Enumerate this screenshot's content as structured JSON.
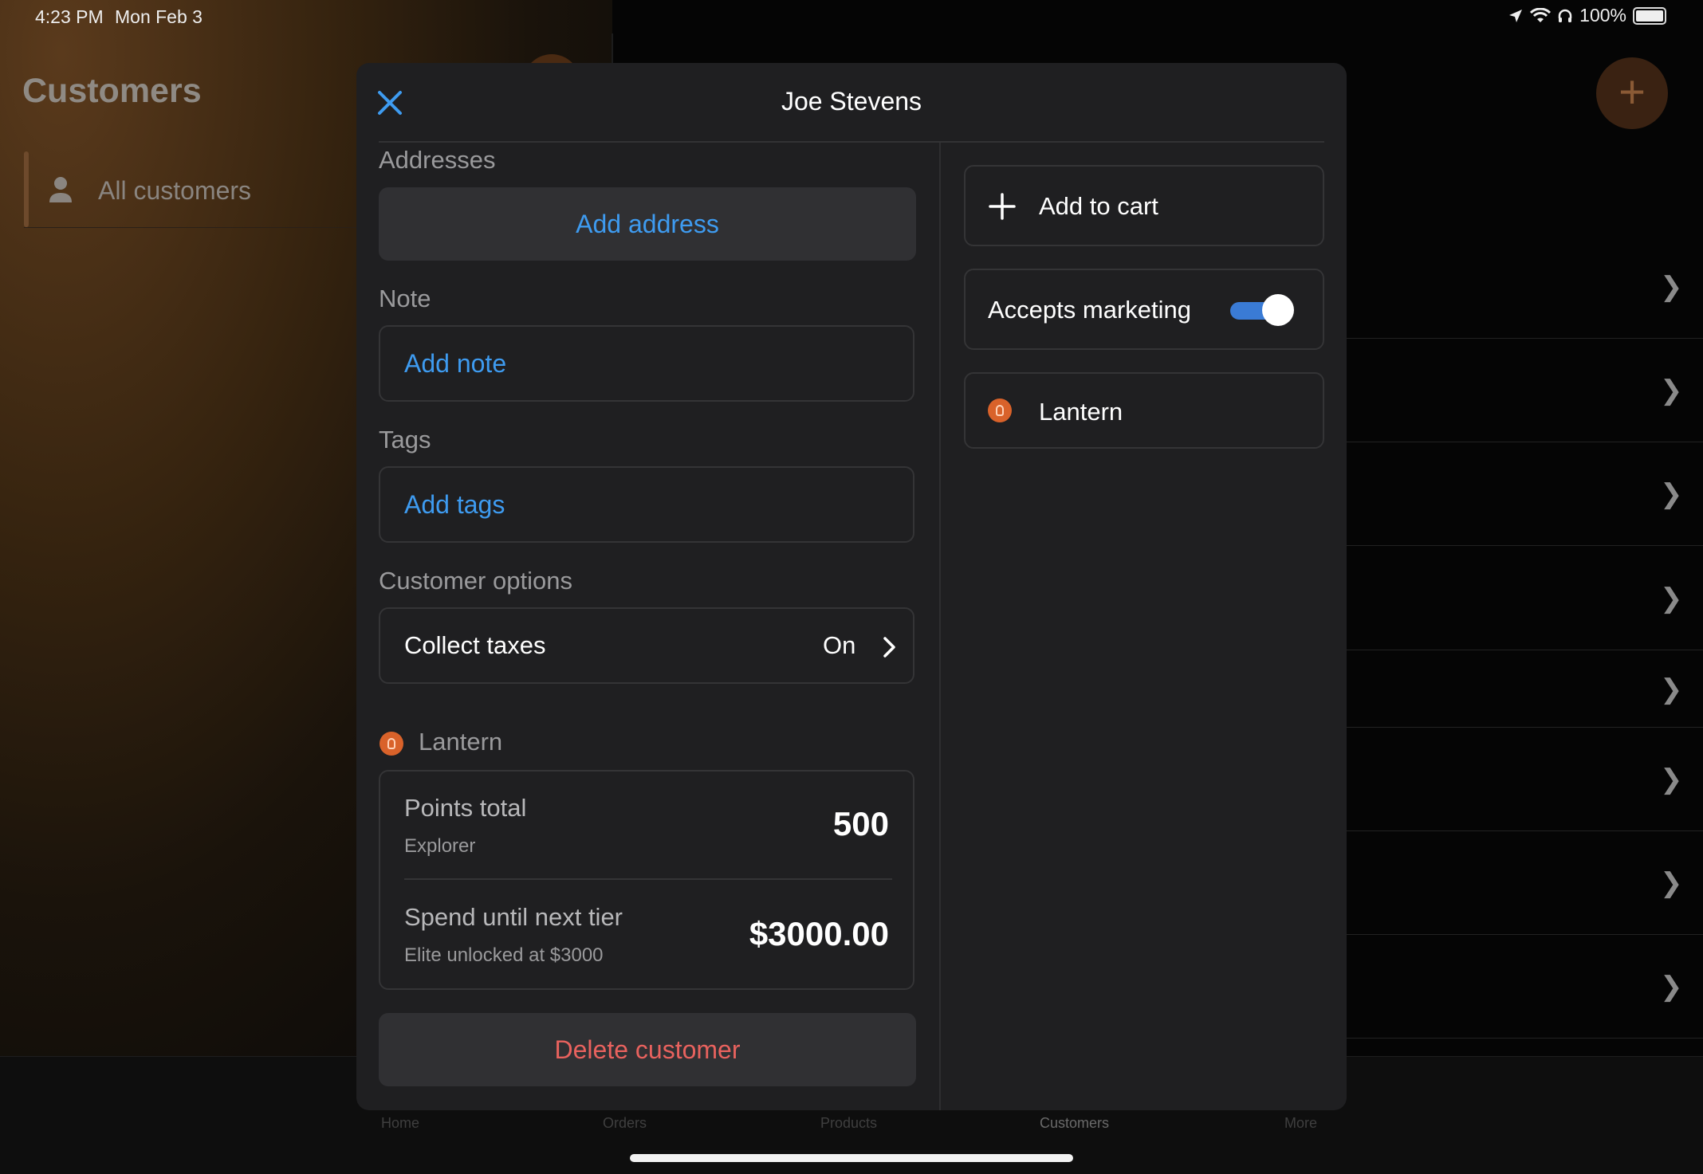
{
  "status_bar": {
    "time": "4:23 PM",
    "date": "Mon Feb 3",
    "battery": "100%",
    "icons": [
      "location-icon",
      "wifi-icon",
      "headphones-icon",
      "battery-icon"
    ]
  },
  "background": {
    "title": "Customers",
    "sidebar_item": "All customers",
    "fab_icon": "+",
    "tabs": [
      "Home",
      "Orders",
      "Products",
      "Customers",
      "More"
    ],
    "active_tab": "Customers"
  },
  "modal": {
    "title": "Joe Stevens",
    "addresses": {
      "label": "Addresses",
      "action": "Add address"
    },
    "note": {
      "label": "Note",
      "action": "Add note"
    },
    "tags": {
      "label": "Tags",
      "action": "Add tags"
    },
    "customer_options": {
      "label": "Customer options",
      "collect_taxes": {
        "label": "Collect taxes",
        "value": "On"
      }
    },
    "loyalty": {
      "label": "Lantern",
      "points_total": {
        "label": "Points total",
        "tier": "Explorer",
        "value": "500"
      },
      "next_tier": {
        "label": "Spend until next tier",
        "sub": "Elite unlocked at $3000",
        "value": "$3000.00"
      }
    },
    "delete_button": "Delete customer",
    "right": {
      "add_to_cart": "Add to cart",
      "accepts_marketing": {
        "label": "Accepts marketing",
        "enabled": true
      },
      "app_card": "Lantern"
    }
  },
  "colors": {
    "accent_blue": "#3e9bf0",
    "danger": "#e8625e",
    "loyalty_orange": "#d9622a"
  }
}
